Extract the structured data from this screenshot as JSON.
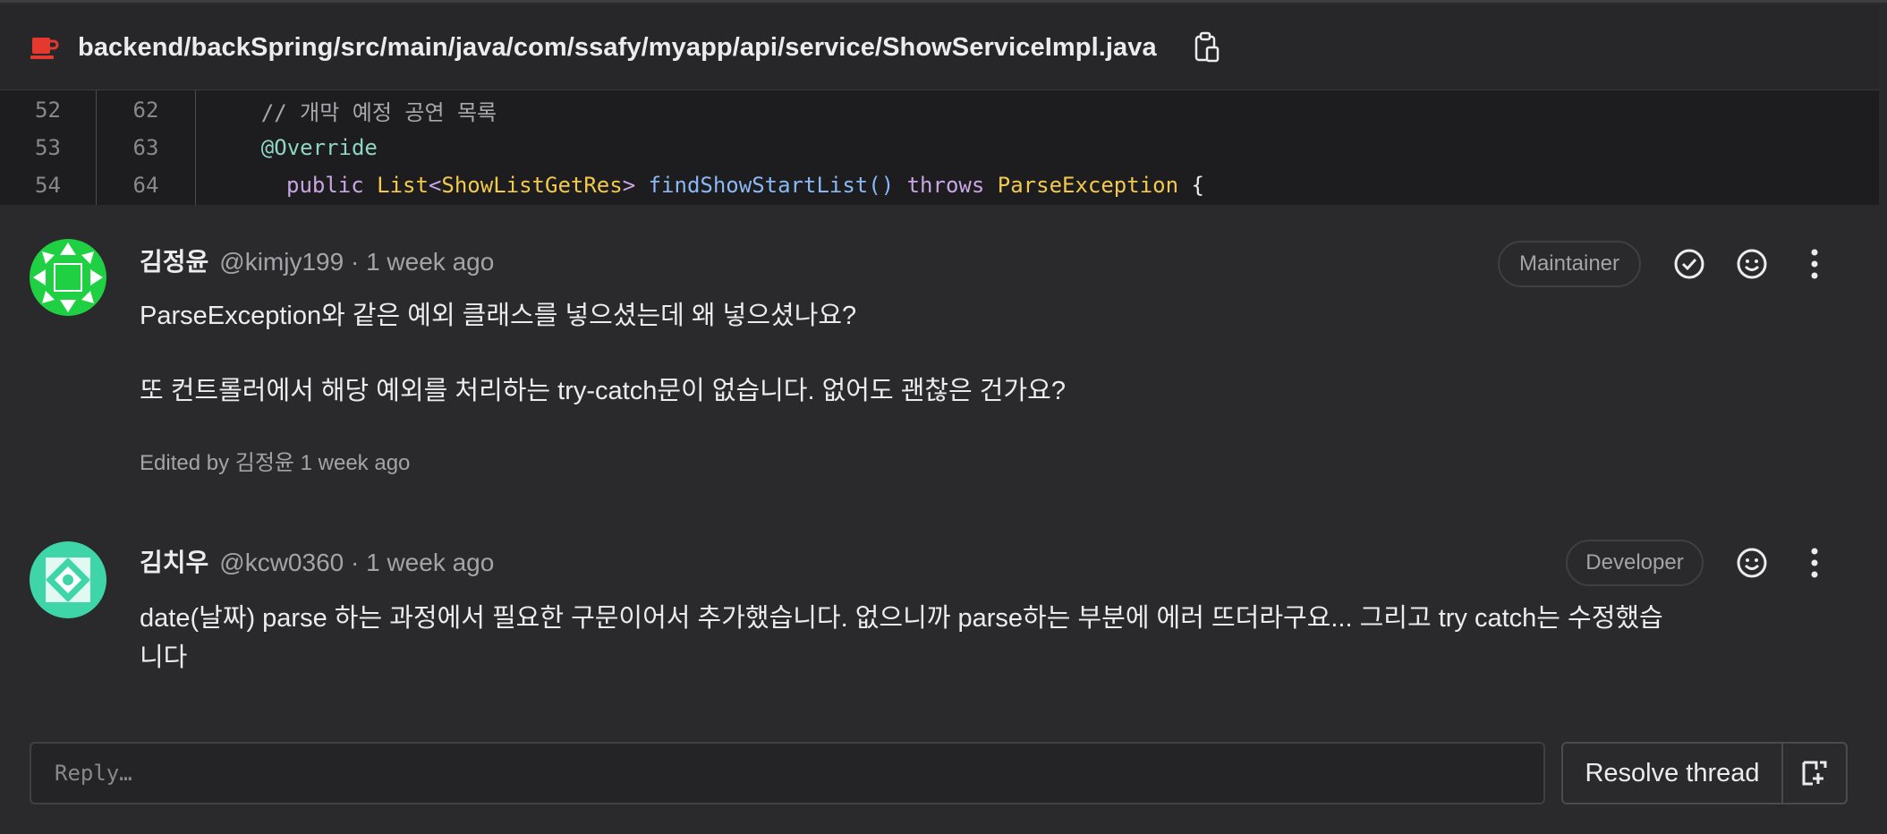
{
  "file": {
    "path": "backend/backSpring/src/main/java/com/ssafy/myapp/api/service/ShowServiceImpl.java",
    "icon": "java-file-icon",
    "copy_icon": "copy-path-icon"
  },
  "code": {
    "lines": [
      {
        "old": "52",
        "new": "62",
        "text": "    // 개막 예정 공연 목록"
      },
      {
        "old": "53",
        "new": "63",
        "text": "    @Override"
      },
      {
        "old": "54",
        "new": "64",
        "text": "    public List<ShowListGetRes> findShowStartList() throws ParseException {"
      }
    ],
    "tokens_line3": {
      "public": "public ",
      "list": "List",
      "lt": "<",
      "res": "ShowListGetRes",
      "gt": "> ",
      "fn": "findShowStartList",
      "parens": "() ",
      "throws": "throws ",
      "exc": "ParseException",
      "brace": " {"
    }
  },
  "notes": [
    {
      "author": "김정윤",
      "meta": "@kimjy199 · 1 week ago",
      "role": "Maintainer",
      "body": [
        "ParseException와 같은 예외 클래스를 넣으셨는데 왜 넣으셨나요?",
        "또 컨트롤러에서 해당 예외를 처리하는 try-catch문이 없습니다. 없어도 괜찮은 건가요?"
      ],
      "edited": "Edited by 김정윤 1 week ago"
    },
    {
      "author": "김치우",
      "meta": "@kcw0360 · 1 week ago",
      "role": "Developer",
      "body": [
        "date(날짜) parse 하는 과정에서 필요한 구문이어서 추가했습니다. 없으니까 parse하는 부분에 에러 뜨더라구요... 그리고 try catch는 수정했습",
        "니다"
      ]
    }
  ],
  "reply": {
    "placeholder": "Reply…"
  },
  "actions": {
    "resolve_label": "Resolve thread"
  },
  "colors": {
    "background": "#2a2a2d",
    "code_background": "#1d1d20",
    "avatar1": "#1fd142",
    "avatar2": "#3ed6a8"
  }
}
